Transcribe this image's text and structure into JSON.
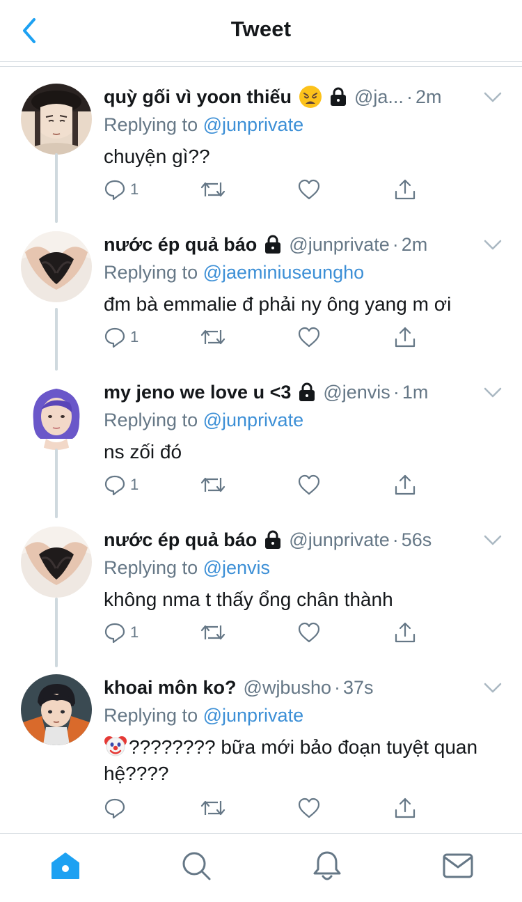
{
  "header": {
    "title": "Tweet",
    "back_icon": "chevron-left-icon"
  },
  "colors": {
    "accent": "#1da1f2",
    "link": "#3c8fd6",
    "secondary_text": "#657786",
    "primary_text": "#14171a",
    "divider": "#d8dee3"
  },
  "tweets": [
    {
      "name": "quỳ gối vì yoon thiếu",
      "name_emoji": "weary-face-emoji",
      "locked": true,
      "handle": "@ja...",
      "separator": "·",
      "time": "2m",
      "reply_prefix": "Replying to",
      "reply_to": "@junprivate",
      "text": "chuyện gì??",
      "reply_count": "1"
    },
    {
      "name": "nước ép quả báo",
      "locked": true,
      "handle": "@junprivate",
      "separator": "·",
      "time": "2m",
      "reply_prefix": "Replying to",
      "reply_to": "@jaeminiuseungho",
      "text": "đm bà emmalie đ phải ny ông yang m ơi",
      "reply_count": "1"
    },
    {
      "name": "my jeno we love u <3",
      "locked": true,
      "handle": "@jenvis",
      "separator": "·",
      "time": "1m",
      "reply_prefix": "Replying to",
      "reply_to": "@junprivate",
      "text": "ns zối đó",
      "reply_count": "1"
    },
    {
      "name": "nước ép quả báo",
      "locked": true,
      "handle": "@junprivate",
      "separator": "·",
      "time": "56s",
      "reply_prefix": "Replying to",
      "reply_to": "@jenvis",
      "text": "không nma t thấy ổng chân thành",
      "reply_count": "1"
    },
    {
      "name": "khoai môn ko?",
      "locked": false,
      "handle": "@wjbusho",
      "separator": "·",
      "time": "37s",
      "reply_prefix": "Replying to",
      "reply_to": "@junprivate",
      "text_emoji": "clown-face-emoji",
      "text": "???????? bữa mới bảo đoạn tuyệt quan hệ????",
      "reply_count": ""
    }
  ],
  "tabbar": {
    "items": [
      "home-icon",
      "search-icon",
      "notifications-icon",
      "messages-icon"
    ],
    "active": "home-icon"
  }
}
